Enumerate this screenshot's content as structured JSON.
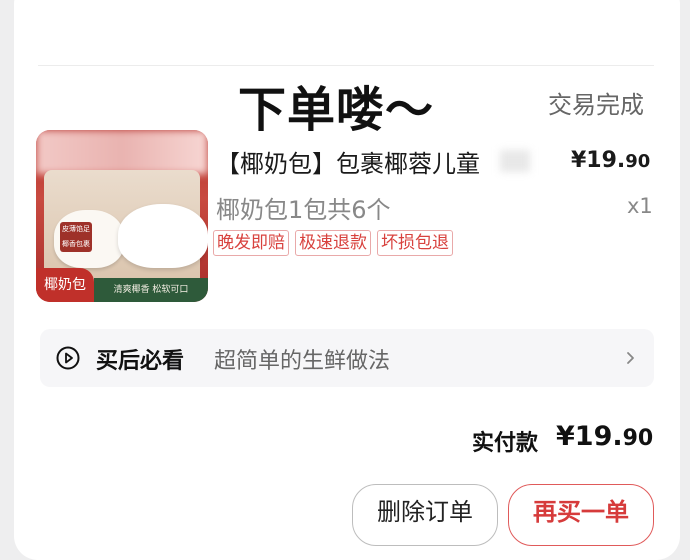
{
  "overlay_title": "下单喽～",
  "order": {
    "status": "交易完成",
    "product": {
      "name": "【椰奶包】包裹椰蓉儿童",
      "price_main": "¥19.",
      "price_cents": "90",
      "spec": "椰奶包1包共6个",
      "quantity": "x1",
      "image": {
        "badge": "椰奶包",
        "strip": "清爽椰香  松软可口",
        "tag": "皮薄馅足 椰香包裹"
      }
    },
    "service_tags": [
      "晚发即赔",
      "极速退款",
      "坏损包退"
    ]
  },
  "guide": {
    "icon": "play-circle-icon",
    "title": "买后必看",
    "description": "超简单的生鲜做法"
  },
  "payment": {
    "label": "实付款",
    "amount_main": "¥19.",
    "amount_cents": "90"
  },
  "actions": {
    "delete_label": "删除订单",
    "rebuy_label": "再买一单"
  },
  "colors": {
    "accent": "#d63b3b",
    "tag_border": "#e9a9a9"
  }
}
